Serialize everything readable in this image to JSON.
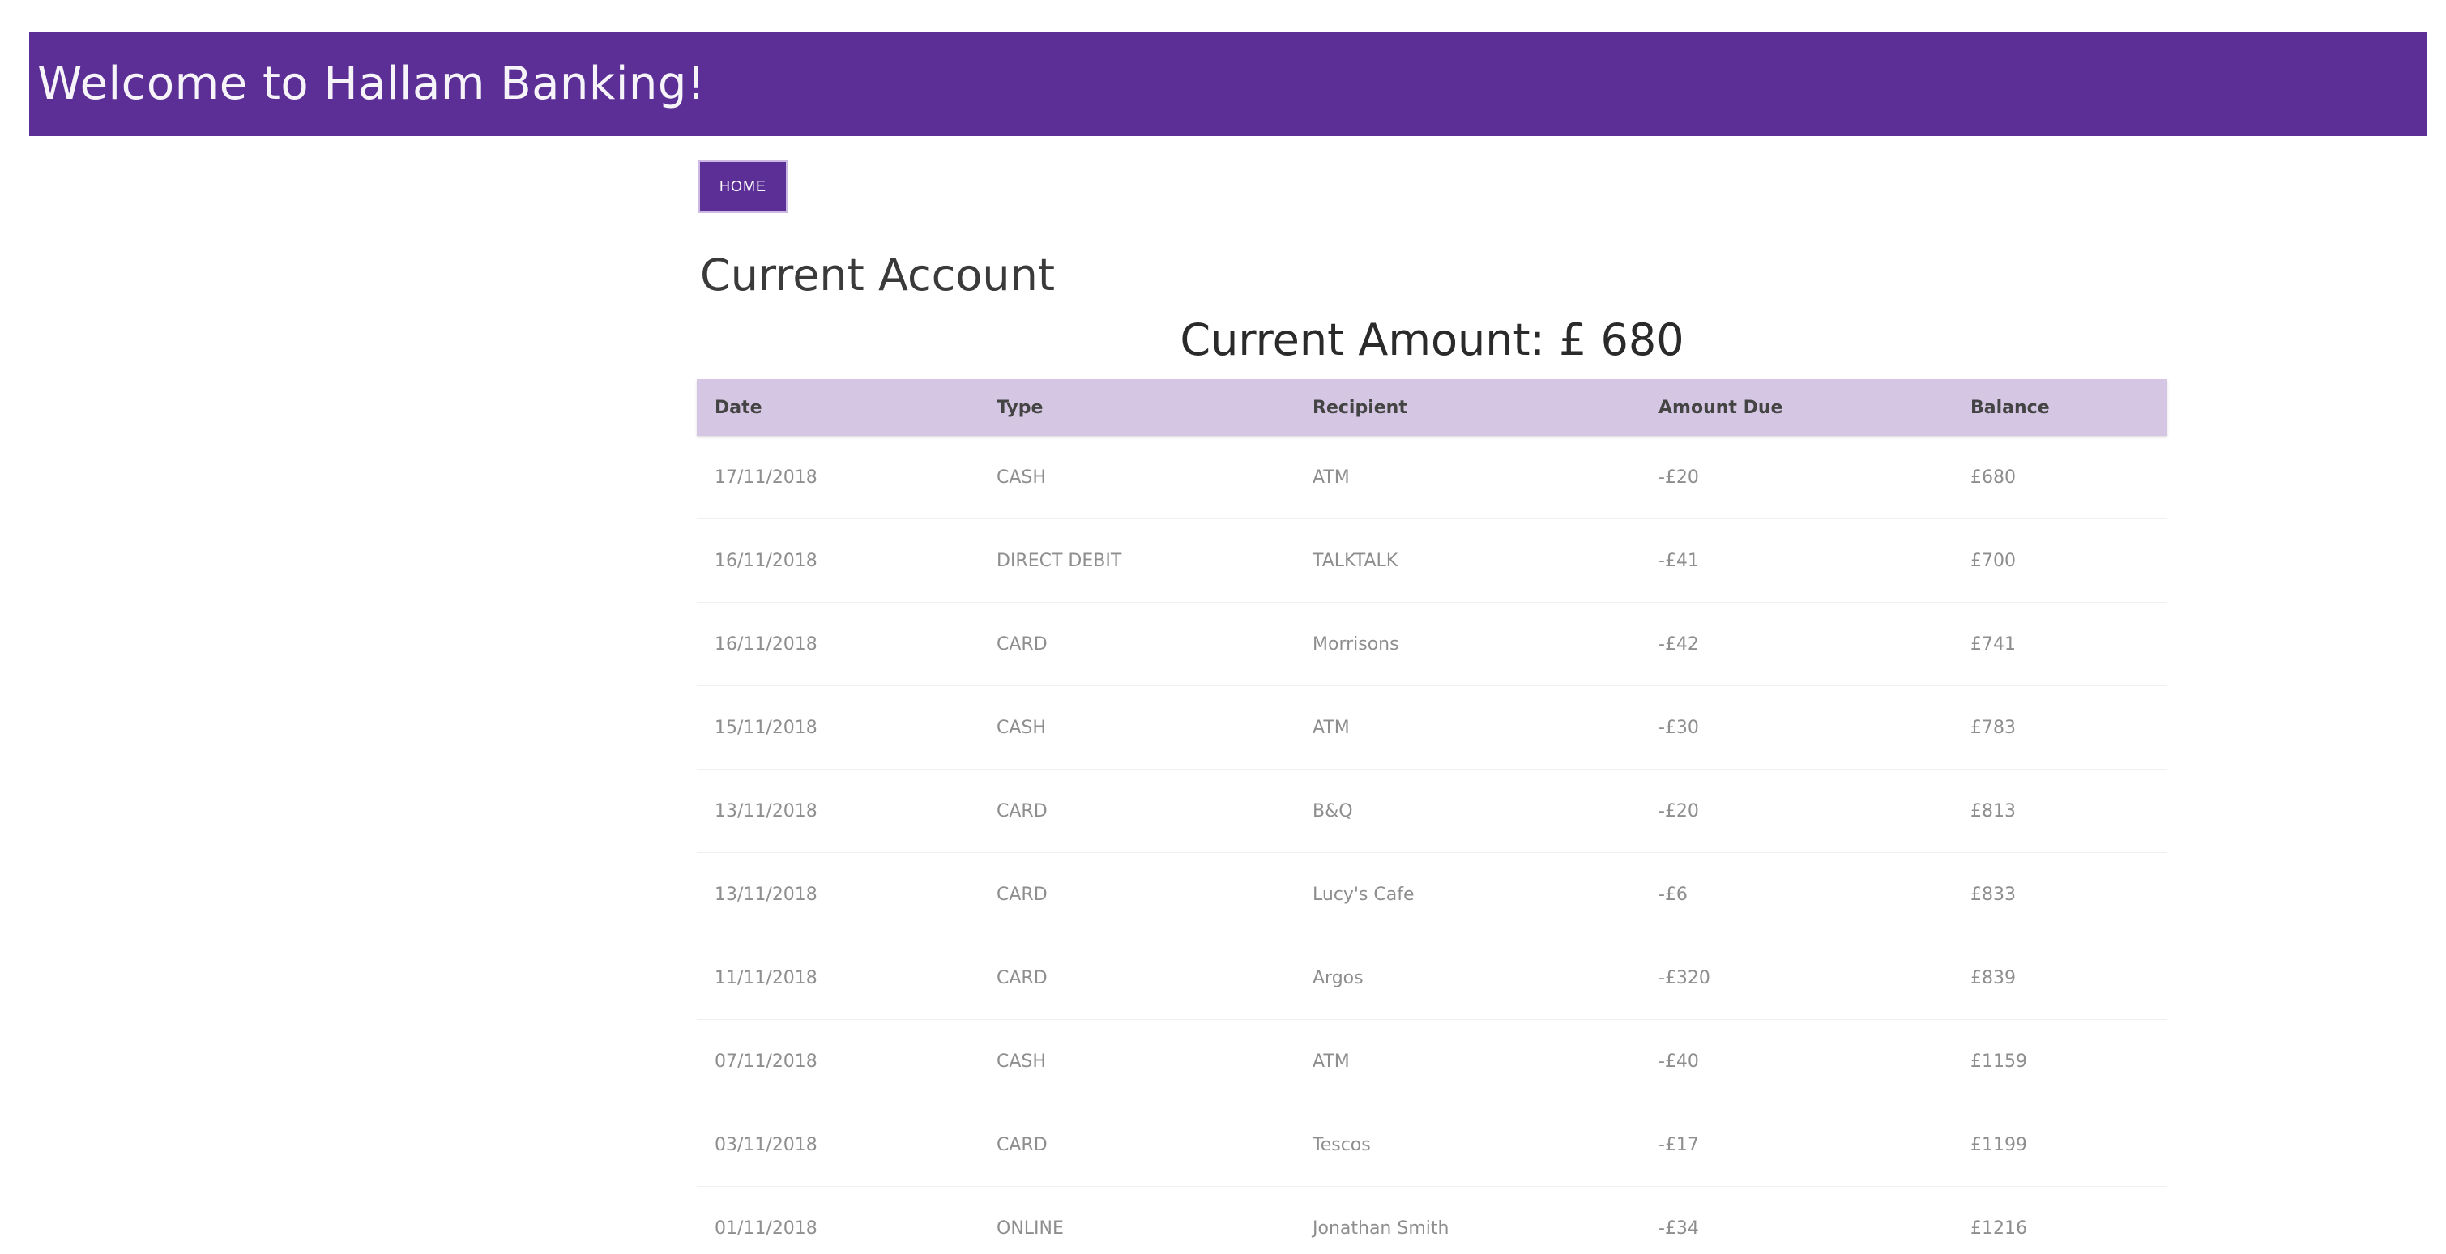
{
  "header": {
    "title": "Welcome to Hallam Banking!"
  },
  "nav": {
    "home_label": "HOME"
  },
  "account": {
    "title": "Current Account",
    "current_amount": "Current Amount: £ 680"
  },
  "table": {
    "columns": [
      "Date",
      "Type",
      "Recipient",
      "Amount Due",
      "Balance"
    ],
    "rows": [
      {
        "date": "17/11/2018",
        "type": "CASH",
        "recipient": "ATM",
        "amount_due": "-£20",
        "balance": "£680"
      },
      {
        "date": "16/11/2018",
        "type": "DIRECT DEBIT",
        "recipient": "TALKTALK",
        "amount_due": "-£41",
        "balance": "£700"
      },
      {
        "date": "16/11/2018",
        "type": "CARD",
        "recipient": "Morrisons",
        "amount_due": "-£42",
        "balance": "£741"
      },
      {
        "date": "15/11/2018",
        "type": "CASH",
        "recipient": "ATM",
        "amount_due": "-£30",
        "balance": "£783"
      },
      {
        "date": "13/11/2018",
        "type": "CARD",
        "recipient": "B&Q",
        "amount_due": "-£20",
        "balance": "£813"
      },
      {
        "date": "13/11/2018",
        "type": "CARD",
        "recipient": "Lucy's Cafe",
        "amount_due": "-£6",
        "balance": "£833"
      },
      {
        "date": "11/11/2018",
        "type": "CARD",
        "recipient": "Argos",
        "amount_due": "-£320",
        "balance": "£839"
      },
      {
        "date": "07/11/2018",
        "type": "CASH",
        "recipient": "ATM",
        "amount_due": "-£40",
        "balance": "£1159"
      },
      {
        "date": "03/11/2018",
        "type": "CARD",
        "recipient": "Tescos",
        "amount_due": "-£17",
        "balance": "£1199"
      },
      {
        "date": "01/11/2018",
        "type": "ONLINE",
        "recipient": "Jonathan Smith",
        "amount_due": "-£34",
        "balance": "£1216"
      }
    ]
  },
  "colors": {
    "brand": "#5b2f96",
    "table_header": "#d5c7e3"
  }
}
